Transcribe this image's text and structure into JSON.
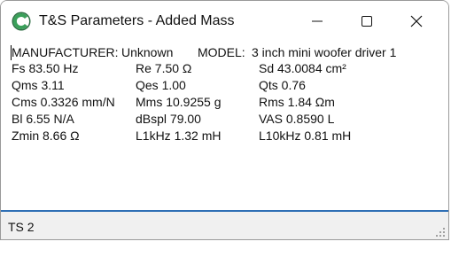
{
  "window": {
    "title": "T&S Parameters - Added Mass",
    "app_icon": "app-logo-c-icon",
    "controls": {
      "minimize": "minimize-icon",
      "maximize": "maximize-icon",
      "close": "close-icon"
    }
  },
  "header": {
    "manufacturer_label": "MANUFACTURER:",
    "manufacturer_value": "Unknown",
    "model_label": "MODEL:",
    "model_value": "3 inch mini woofer driver 1"
  },
  "params": [
    [
      "Fs  83.50 Hz",
      "Re  7.50 Ω",
      "Sd  43.0084 cm²"
    ],
    [
      "Qms 3.11",
      "Qes 1.00",
      "Qts 0.76"
    ],
    [
      "Cms 0.3326 mm/N",
      "Mms 10.9255 g",
      "Rms 1.84 Ωm"
    ],
    [
      "Bl  6.55 N/A",
      "dBspl 79.00",
      "VAS  0.8590 L"
    ],
    [
      "Zmin  8.66 Ω",
      "L1kHz  1.32 mH",
      "L10kHz 0.81 mH"
    ]
  ],
  "status": {
    "text": "TS 2"
  },
  "colors": {
    "accent": "#2f6fb5",
    "logo_green": "#3aa05a"
  }
}
